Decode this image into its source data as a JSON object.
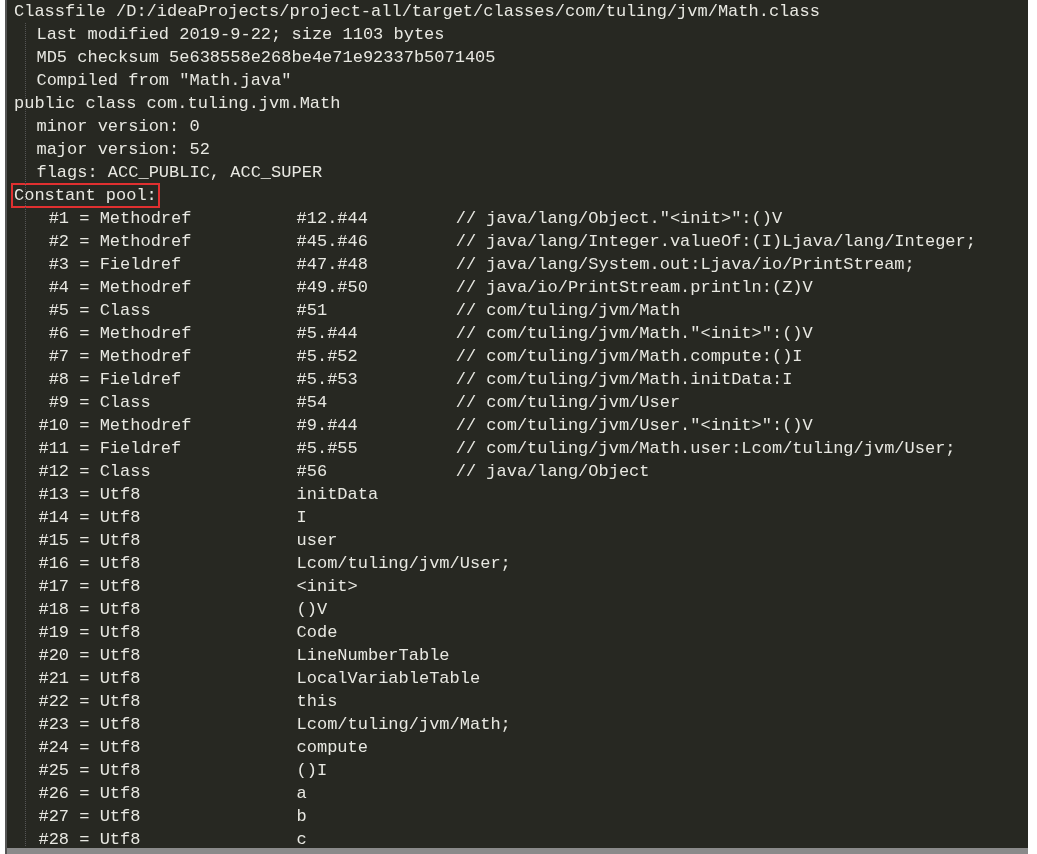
{
  "header": [
    {
      "text": "Classfile /D:/ideaProjects/project-all/target/classes/com/tuling/jvm/Math.class",
      "highlighted": false,
      "children": [
        {
          "text": "Last modified 2019-9-22; size 1103 bytes"
        },
        {
          "text": "MD5 checksum 5e638558e268be4e71e92337b5071405"
        },
        {
          "text": "Compiled from \"Math.java\""
        }
      ]
    },
    {
      "text": "public class com.tuling.jvm.Math",
      "highlighted": false,
      "children": [
        {
          "text": "minor version: 0"
        },
        {
          "text": "major version: 52"
        },
        {
          "text": "flags: ACC_PUBLIC, ACC_SUPER"
        }
      ]
    },
    {
      "text": "Constant pool:",
      "highlighted": true
    }
  ],
  "constant_pool": [
    {
      "index": "#1",
      "sep": "=",
      "type": "Methodref",
      "ref": "#12.#44",
      "comment": "// java/lang/Object.\"<init>\":()V"
    },
    {
      "index": "#2",
      "sep": "=",
      "type": "Methodref",
      "ref": "#45.#46",
      "comment": "// java/lang/Integer.valueOf:(I)Ljava/lang/Integer;"
    },
    {
      "index": "#3",
      "sep": "=",
      "type": "Fieldref",
      "ref": "#47.#48",
      "comment": "// java/lang/System.out:Ljava/io/PrintStream;"
    },
    {
      "index": "#4",
      "sep": "=",
      "type": "Methodref",
      "ref": "#49.#50",
      "comment": "// java/io/PrintStream.println:(Z)V"
    },
    {
      "index": "#5",
      "sep": "=",
      "type": "Class",
      "ref": "#51",
      "comment": "// com/tuling/jvm/Math"
    },
    {
      "index": "#6",
      "sep": "=",
      "type": "Methodref",
      "ref": "#5.#44",
      "comment": "// com/tuling/jvm/Math.\"<init>\":()V"
    },
    {
      "index": "#7",
      "sep": "=",
      "type": "Methodref",
      "ref": "#5.#52",
      "comment": "// com/tuling/jvm/Math.compute:()I"
    },
    {
      "index": "#8",
      "sep": "=",
      "type": "Fieldref",
      "ref": "#5.#53",
      "comment": "// com/tuling/jvm/Math.initData:I"
    },
    {
      "index": "#9",
      "sep": "=",
      "type": "Class",
      "ref": "#54",
      "comment": "// com/tuling/jvm/User"
    },
    {
      "index": "#10",
      "sep": "=",
      "type": "Methodref",
      "ref": "#9.#44",
      "comment": "// com/tuling/jvm/User.\"<init>\":()V"
    },
    {
      "index": "#11",
      "sep": "=",
      "type": "Fieldref",
      "ref": "#5.#55",
      "comment": "// com/tuling/jvm/Math.user:Lcom/tuling/jvm/User;"
    },
    {
      "index": "#12",
      "sep": "=",
      "type": "Class",
      "ref": "#56",
      "comment": "// java/lang/Object"
    },
    {
      "index": "#13",
      "sep": "=",
      "type": "Utf8",
      "ref": "initData"
    },
    {
      "index": "#14",
      "sep": "=",
      "type": "Utf8",
      "ref": "I"
    },
    {
      "index": "#15",
      "sep": "=",
      "type": "Utf8",
      "ref": "user"
    },
    {
      "index": "#16",
      "sep": "=",
      "type": "Utf8",
      "ref": "Lcom/tuling/jvm/User;"
    },
    {
      "index": "#17",
      "sep": "=",
      "type": "Utf8",
      "ref": "<init>"
    },
    {
      "index": "#18",
      "sep": "=",
      "type": "Utf8",
      "ref": "()V"
    },
    {
      "index": "#19",
      "sep": "=",
      "type": "Utf8",
      "ref": "Code"
    },
    {
      "index": "#20",
      "sep": "=",
      "type": "Utf8",
      "ref": "LineNumberTable"
    },
    {
      "index": "#21",
      "sep": "=",
      "type": "Utf8",
      "ref": "LocalVariableTable"
    },
    {
      "index": "#22",
      "sep": "=",
      "type": "Utf8",
      "ref": "this"
    },
    {
      "index": "#23",
      "sep": "=",
      "type": "Utf8",
      "ref": "Lcom/tuling/jvm/Math;"
    },
    {
      "index": "#24",
      "sep": "=",
      "type": "Utf8",
      "ref": "compute"
    },
    {
      "index": "#25",
      "sep": "=",
      "type": "Utf8",
      "ref": "()I"
    },
    {
      "index": "#26",
      "sep": "=",
      "type": "Utf8",
      "ref": "a"
    },
    {
      "index": "#27",
      "sep": "=",
      "type": "Utf8",
      "ref": "b"
    },
    {
      "index": "#28",
      "sep": "=",
      "type": "Utf8",
      "ref": "c"
    }
  ]
}
